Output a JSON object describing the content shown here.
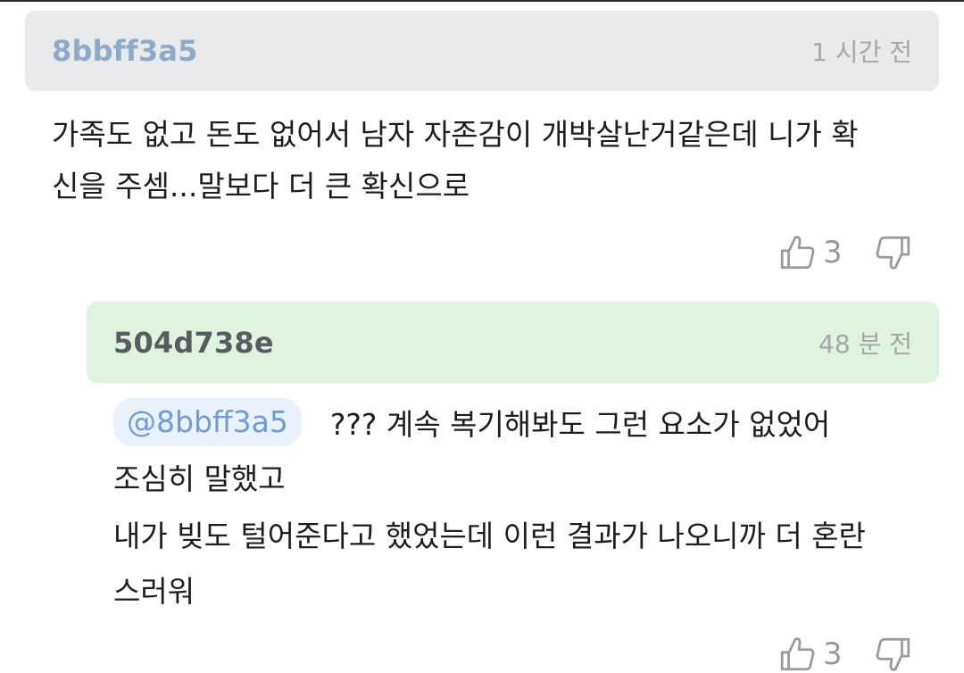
{
  "comment": {
    "author": "8bbff3a5",
    "time": "1 시간 전",
    "lines": [
      "가족도 없고 돈도 없어서 남자 자존감이 개박살난거같은데 니가 확",
      "신을 주셈...말보다 더 큰 확신으로"
    ],
    "like_count": "3"
  },
  "reply": {
    "author": "504d738e",
    "time": "48 분 전",
    "mention": "@8bbff3a5",
    "first_line": "??? 계속 복기해봐도 그런 요소가 없었어",
    "lines": [
      "조심히 말했고",
      "내가 빚도 털어준다고 했었는데 이런 결과가 나오니까 더 혼란",
      "스러워"
    ],
    "like_count": "3"
  },
  "icons": {
    "like": "thumbs-up-icon",
    "dislike": "thumbs-down-icon"
  },
  "colors": {
    "header_main_bg": "#e9eaec",
    "header_reply_bg": "#dff4de",
    "mention_bg": "#e9f1fb",
    "mention_text": "#6f9cd4",
    "author_main": "#8eaac6"
  }
}
